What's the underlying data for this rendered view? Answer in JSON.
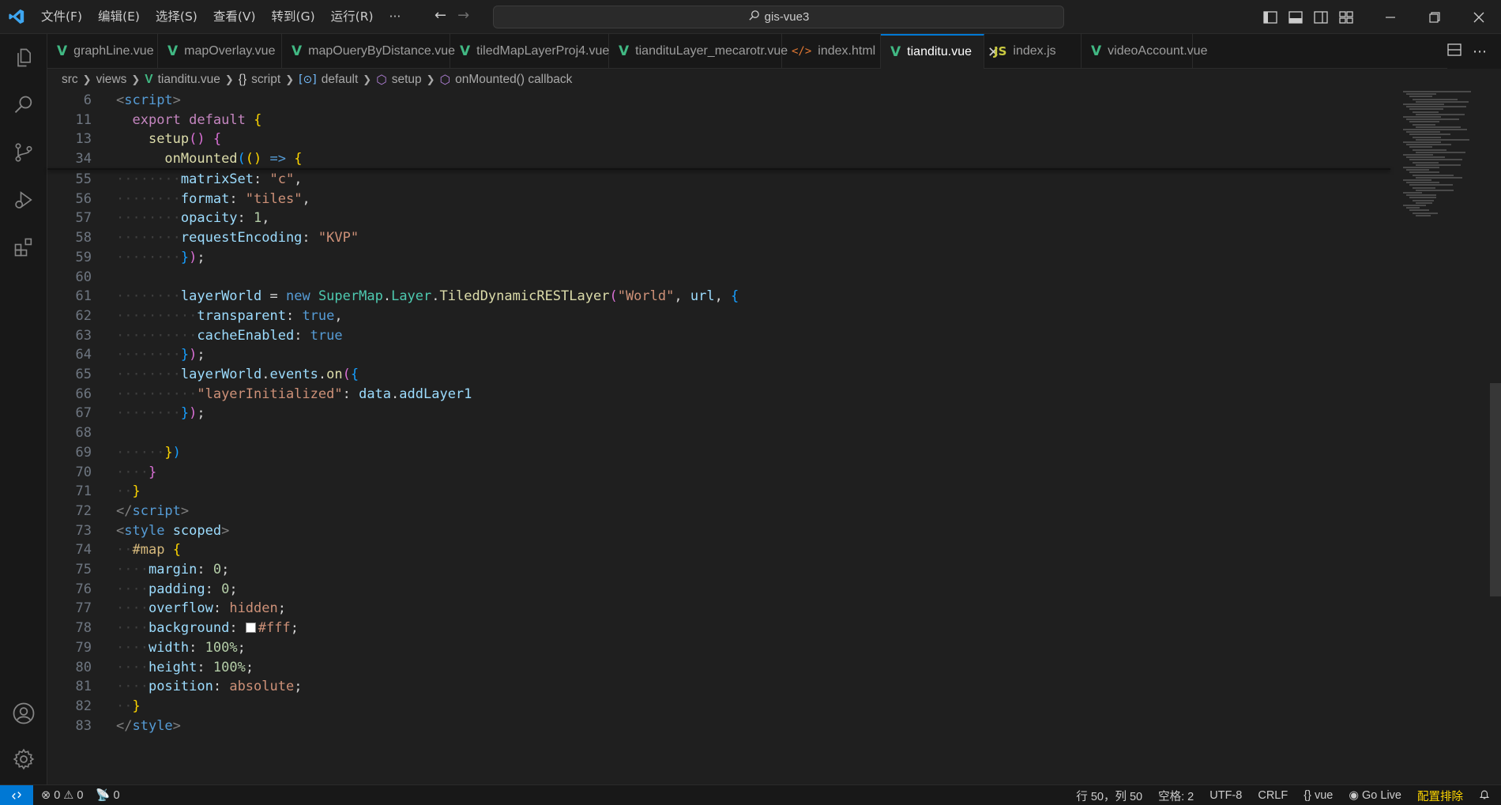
{
  "menu": {
    "items": [
      "文件(F)",
      "编辑(E)",
      "选择(S)",
      "查看(V)",
      "转到(G)",
      "运行(R)",
      "···"
    ]
  },
  "title": {
    "search_text": "gis-vue3"
  },
  "tabs": [
    {
      "label": "graphLine.vue",
      "type": "vue"
    },
    {
      "label": "mapOverlay.vue",
      "type": "vue"
    },
    {
      "label": "mapOueryByDistance.vue",
      "type": "vue"
    },
    {
      "label": "tiledMapLayerProj4.vue",
      "type": "vue"
    },
    {
      "label": "tiandituLayer_mecarotr.vue",
      "type": "vue"
    },
    {
      "label": "index.html",
      "type": "html",
      "icon": "</>"
    },
    {
      "label": "tianditu.vue",
      "type": "vue",
      "active": true
    },
    {
      "label": "index.js",
      "type": "js",
      "icon": "JS"
    },
    {
      "label": "videoAccount.vue",
      "type": "vue"
    }
  ],
  "breadcrumb": [
    "src",
    "views",
    "tianditu.vue",
    "script",
    "default",
    "setup",
    "onMounted() callback"
  ],
  "sticky_lines": [
    {
      "n": "6",
      "tokens": [
        [
          "k-tag",
          "<"
        ],
        [
          "k-tname",
          "script"
        ],
        [
          "k-tag",
          ">"
        ]
      ]
    },
    {
      "n": "11",
      "tokens": [
        [
          "k-def",
          "  "
        ],
        [
          "k-kw",
          "export"
        ],
        [
          "k-def",
          " "
        ],
        [
          "k-kw",
          "default"
        ],
        [
          "k-def",
          " "
        ],
        [
          "k-p1",
          "{"
        ]
      ]
    },
    {
      "n": "13",
      "tokens": [
        [
          "k-def",
          "    "
        ],
        [
          "k-fn",
          "setup"
        ],
        [
          "k-p2",
          "()"
        ],
        [
          "k-def",
          " "
        ],
        [
          "k-p2",
          "{"
        ]
      ]
    },
    {
      "n": "34",
      "tokens": [
        [
          "k-def",
          "      "
        ],
        [
          "k-fn",
          "onMounted"
        ],
        [
          "k-p3",
          "("
        ],
        [
          "k-p1",
          "()"
        ],
        [
          "k-def",
          " "
        ],
        [
          "k-tname",
          "=>"
        ],
        [
          "k-def",
          " "
        ],
        [
          "k-p1",
          "{"
        ]
      ]
    }
  ],
  "code_lines": [
    {
      "n": "55",
      "tokens": [
        [
          "ws",
          "········"
        ],
        [
          "k-prop",
          "matrixSet"
        ],
        [
          "k-op",
          ": "
        ],
        [
          "k-str",
          "\"c\""
        ],
        [
          "k-op",
          ","
        ]
      ]
    },
    {
      "n": "56",
      "tokens": [
        [
          "ws",
          "········"
        ],
        [
          "k-prop",
          "format"
        ],
        [
          "k-op",
          ": "
        ],
        [
          "k-str",
          "\"tiles\""
        ],
        [
          "k-op",
          ","
        ]
      ]
    },
    {
      "n": "57",
      "tokens": [
        [
          "ws",
          "········"
        ],
        [
          "k-prop",
          "opacity"
        ],
        [
          "k-op",
          ": "
        ],
        [
          "k-num",
          "1"
        ],
        [
          "k-op",
          ","
        ]
      ]
    },
    {
      "n": "58",
      "tokens": [
        [
          "ws",
          "········"
        ],
        [
          "k-prop",
          "requestEncoding"
        ],
        [
          "k-op",
          ": "
        ],
        [
          "k-str",
          "\"KVP\""
        ]
      ]
    },
    {
      "n": "59",
      "tokens": [
        [
          "ws",
          "········"
        ],
        [
          "k-p3",
          "}"
        ],
        [
          "k-p2",
          ")"
        ],
        [
          "k-op",
          ";"
        ]
      ]
    },
    {
      "n": "60",
      "tokens": []
    },
    {
      "n": "61",
      "tokens": [
        [
          "ws",
          "········"
        ],
        [
          "k-var",
          "layerWorld"
        ],
        [
          "k-op",
          " = "
        ],
        [
          "k-tname",
          "new"
        ],
        [
          "k-def",
          " "
        ],
        [
          "k-cls",
          "SuperMap"
        ],
        [
          "k-op",
          "."
        ],
        [
          "k-cls",
          "Layer"
        ],
        [
          "k-op",
          "."
        ],
        [
          "k-fn",
          "TiledDynamicRESTLayer"
        ],
        [
          "k-p2",
          "("
        ],
        [
          "k-str",
          "\"World\""
        ],
        [
          "k-op",
          ", "
        ],
        [
          "k-var",
          "url"
        ],
        [
          "k-op",
          ", "
        ],
        [
          "k-p3",
          "{"
        ]
      ]
    },
    {
      "n": "62",
      "tokens": [
        [
          "ws",
          "··········"
        ],
        [
          "k-prop",
          "transparent"
        ],
        [
          "k-op",
          ": "
        ],
        [
          "k-bool",
          "true"
        ],
        [
          "k-op",
          ","
        ]
      ]
    },
    {
      "n": "63",
      "tokens": [
        [
          "ws",
          "··········"
        ],
        [
          "k-prop",
          "cacheEnabled"
        ],
        [
          "k-op",
          ": "
        ],
        [
          "k-bool",
          "true"
        ]
      ]
    },
    {
      "n": "64",
      "tokens": [
        [
          "ws",
          "········"
        ],
        [
          "k-p3",
          "}"
        ],
        [
          "k-p2",
          ")"
        ],
        [
          "k-op",
          ";"
        ]
      ]
    },
    {
      "n": "65",
      "tokens": [
        [
          "ws",
          "········"
        ],
        [
          "k-var",
          "layerWorld"
        ],
        [
          "k-op",
          "."
        ],
        [
          "k-var",
          "events"
        ],
        [
          "k-op",
          "."
        ],
        [
          "k-fn",
          "on"
        ],
        [
          "k-p2",
          "("
        ],
        [
          "k-p3",
          "{"
        ]
      ]
    },
    {
      "n": "66",
      "tokens": [
        [
          "ws",
          "··········"
        ],
        [
          "k-str",
          "\"layerInitialized\""
        ],
        [
          "k-op",
          ": "
        ],
        [
          "k-var",
          "data"
        ],
        [
          "k-op",
          "."
        ],
        [
          "k-var",
          "addLayer1"
        ]
      ]
    },
    {
      "n": "67",
      "tokens": [
        [
          "ws",
          "········"
        ],
        [
          "k-p3",
          "}"
        ],
        [
          "k-p2",
          ")"
        ],
        [
          "k-op",
          ";"
        ]
      ]
    },
    {
      "n": "68",
      "tokens": []
    },
    {
      "n": "69",
      "tokens": [
        [
          "ws",
          "······"
        ],
        [
          "k-p1",
          "}"
        ],
        [
          "k-p3",
          ")"
        ]
      ]
    },
    {
      "n": "70",
      "tokens": [
        [
          "ws",
          "····"
        ],
        [
          "k-p2",
          "}"
        ]
      ]
    },
    {
      "n": "71",
      "tokens": [
        [
          "ws",
          "··"
        ],
        [
          "k-p1",
          "}"
        ]
      ]
    },
    {
      "n": "72",
      "tokens": [
        [
          "k-tag",
          "</"
        ],
        [
          "k-tname",
          "script"
        ],
        [
          "k-tag",
          ">"
        ]
      ]
    },
    {
      "n": "73",
      "tokens": [
        [
          "k-tag",
          "<"
        ],
        [
          "k-tname",
          "style"
        ],
        [
          "k-def",
          " "
        ],
        [
          "k-var",
          "scoped"
        ],
        [
          "k-tag",
          ">"
        ]
      ]
    },
    {
      "n": "74",
      "tokens": [
        [
          "ws",
          "··"
        ],
        [
          "k-sel",
          "#map"
        ],
        [
          "k-def",
          " "
        ],
        [
          "k-p1",
          "{"
        ]
      ]
    },
    {
      "n": "75",
      "tokens": [
        [
          "ws",
          "····"
        ],
        [
          "k-prop",
          "margin"
        ],
        [
          "k-op",
          ": "
        ],
        [
          "k-num",
          "0"
        ],
        [
          "k-op",
          ";"
        ]
      ]
    },
    {
      "n": "76",
      "tokens": [
        [
          "ws",
          "····"
        ],
        [
          "k-prop",
          "padding"
        ],
        [
          "k-op",
          ": "
        ],
        [
          "k-num",
          "0"
        ],
        [
          "k-op",
          ";"
        ]
      ]
    },
    {
      "n": "77",
      "tokens": [
        [
          "ws",
          "····"
        ],
        [
          "k-prop",
          "overflow"
        ],
        [
          "k-op",
          ": "
        ],
        [
          "k-cssv",
          "hidden"
        ],
        [
          "k-op",
          ";"
        ]
      ]
    },
    {
      "n": "78",
      "tokens": [
        [
          "ws",
          "····"
        ],
        [
          "k-prop",
          "background"
        ],
        [
          "k-op",
          ": "
        ],
        [
          "swatch",
          ""
        ],
        [
          "k-cssv",
          "#fff"
        ],
        [
          "k-op",
          ";"
        ]
      ]
    },
    {
      "n": "79",
      "tokens": [
        [
          "ws",
          "····"
        ],
        [
          "k-prop",
          "width"
        ],
        [
          "k-op",
          ": "
        ],
        [
          "k-num",
          "100%"
        ],
        [
          "k-op",
          ";"
        ]
      ]
    },
    {
      "n": "80",
      "tokens": [
        [
          "ws",
          "····"
        ],
        [
          "k-prop",
          "height"
        ],
        [
          "k-op",
          ": "
        ],
        [
          "k-num",
          "100%"
        ],
        [
          "k-op",
          ";"
        ]
      ]
    },
    {
      "n": "81",
      "tokens": [
        [
          "ws",
          "····"
        ],
        [
          "k-prop",
          "position"
        ],
        [
          "k-op",
          ": "
        ],
        [
          "k-cssv",
          "absolute"
        ],
        [
          "k-op",
          ";"
        ]
      ]
    },
    {
      "n": "82",
      "tokens": [
        [
          "ws",
          "··"
        ],
        [
          "k-p1",
          "}"
        ]
      ]
    },
    {
      "n": "83",
      "tokens": [
        [
          "k-tag",
          "</"
        ],
        [
          "k-tname",
          "style"
        ],
        [
          "k-tag",
          ">"
        ]
      ]
    }
  ],
  "status": {
    "errors": "0",
    "warnings": "0",
    "ports": "0",
    "position": "行 50，列 50",
    "spaces": "空格: 2",
    "encoding": "UTF-8",
    "eol": "CRLF",
    "language": "vue",
    "golive": "Go Live",
    "config": "配置排除"
  },
  "colors": {
    "accent": "#0078d4",
    "vue": "#41b883",
    "js": "#cbcb41"
  }
}
